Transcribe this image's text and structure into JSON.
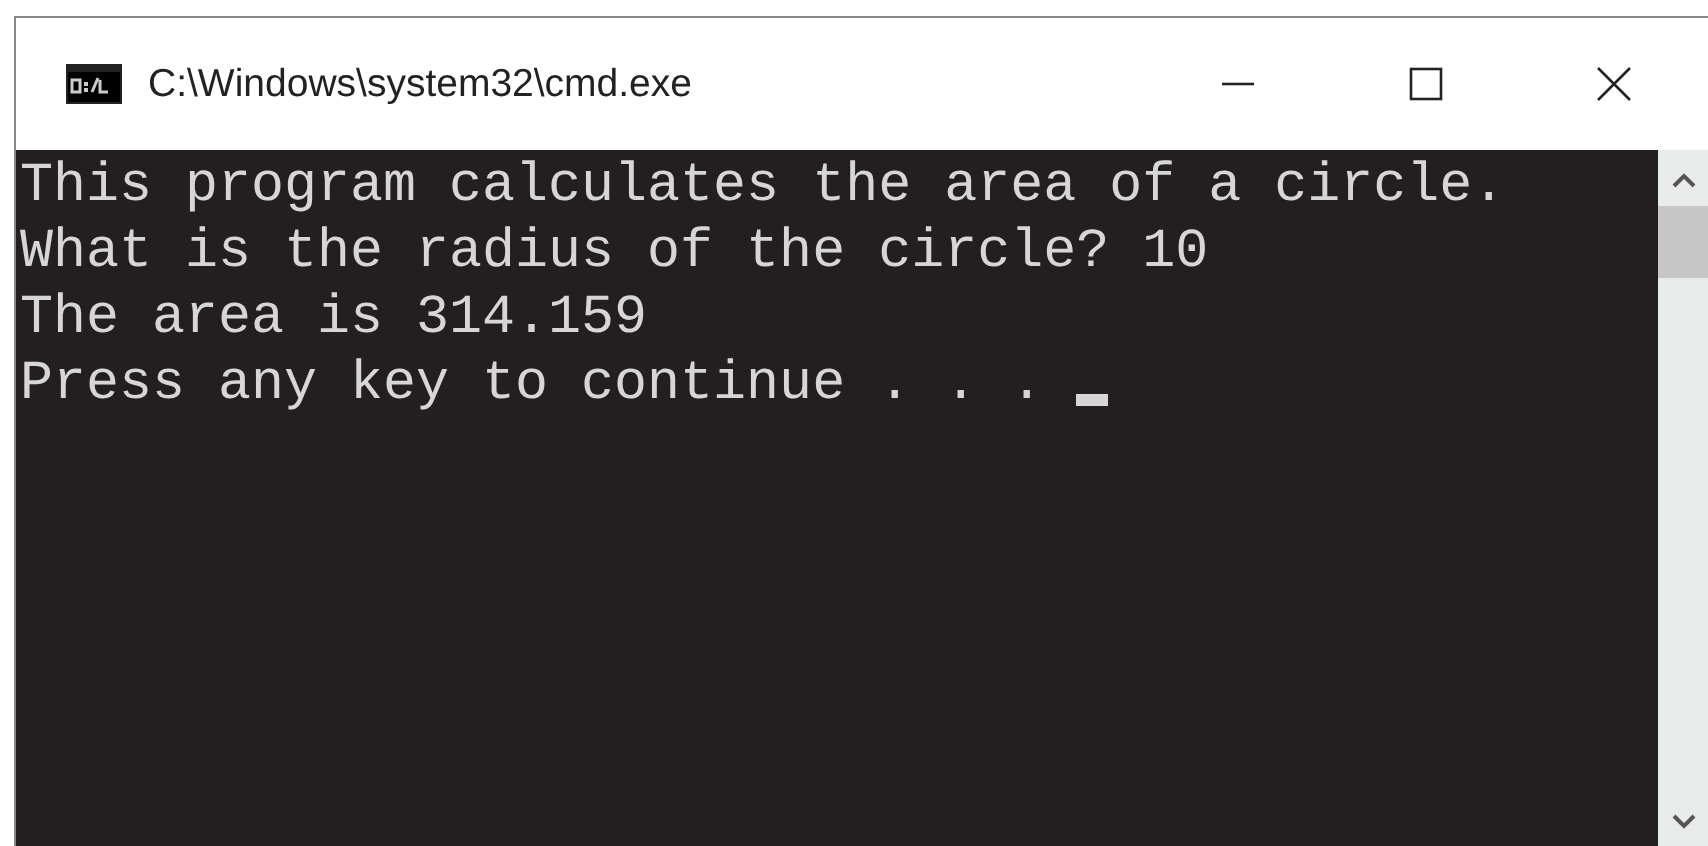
{
  "window": {
    "title": "C:\\Windows\\system32\\cmd.exe"
  },
  "console": {
    "lines": [
      "This program calculates the area of a circle.",
      "What is the radius of the circle? 10",
      "The area is 314.159",
      "Press any key to continue . . . "
    ],
    "cursor": true
  }
}
